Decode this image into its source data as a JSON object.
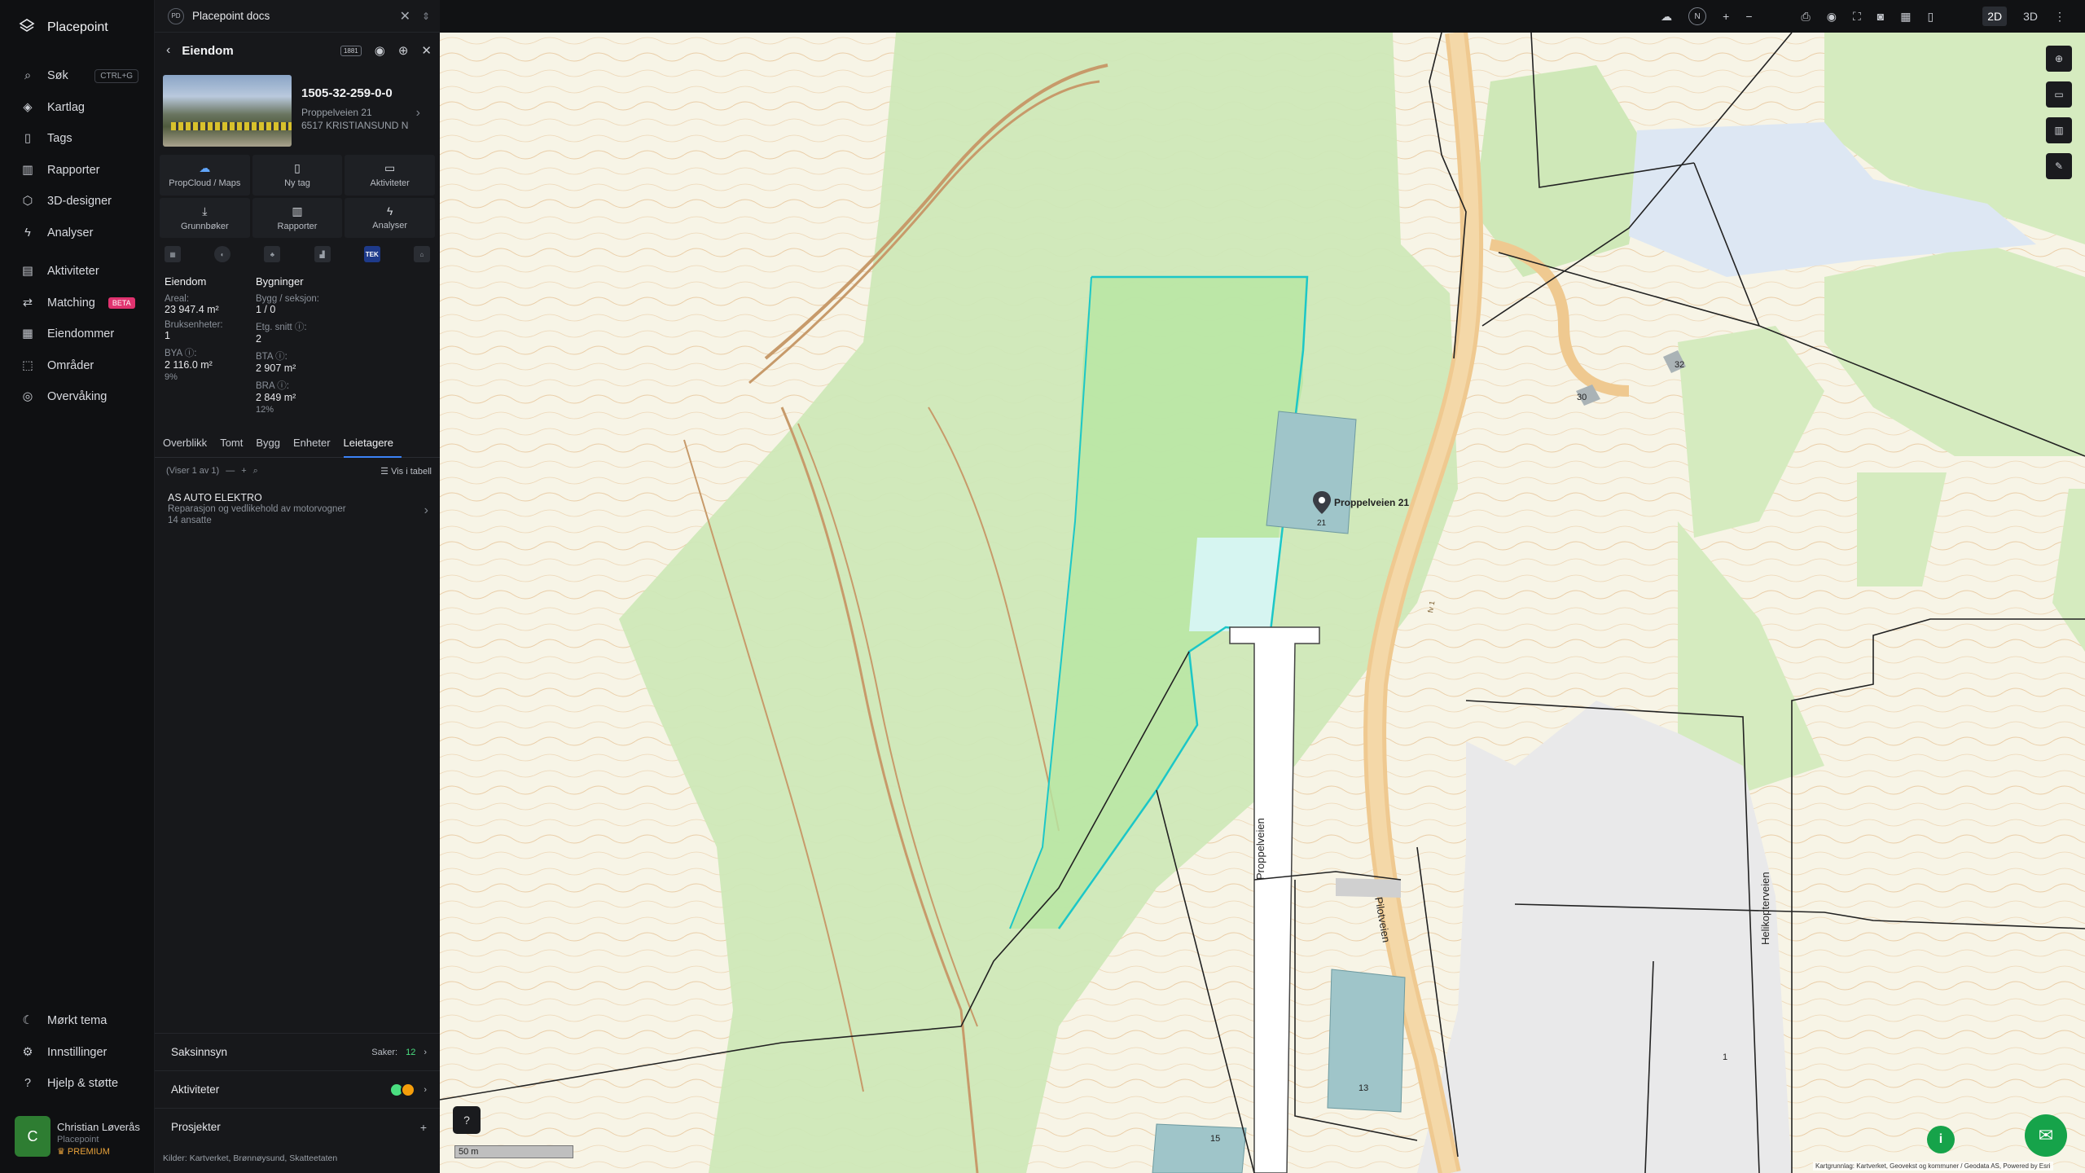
{
  "app": {
    "name": "Placepoint"
  },
  "nav": {
    "items": [
      {
        "label": "Søk",
        "icon": "search-icon",
        "shortcut": "CTRL+G"
      },
      {
        "label": "Kartlag",
        "icon": "layers-icon"
      },
      {
        "label": "Tags",
        "icon": "bookmark-icon"
      },
      {
        "label": "Rapporter",
        "icon": "chart-icon"
      },
      {
        "label": "3D-designer",
        "icon": "cube-icon"
      },
      {
        "label": "Analyser",
        "icon": "bolt-icon"
      }
    ],
    "items2": [
      {
        "label": "Aktiviteter",
        "icon": "activity-icon"
      },
      {
        "label": "Matching",
        "icon": "matching-icon",
        "badge": "BETA"
      },
      {
        "label": "Eiendommer",
        "icon": "building-icon"
      },
      {
        "label": "Områder",
        "icon": "area-icon"
      },
      {
        "label": "Overvåking",
        "icon": "monitor-icon"
      }
    ],
    "bottom": [
      {
        "label": "Mørkt tema",
        "icon": "moon-icon"
      },
      {
        "label": "Innstillinger",
        "icon": "gear-icon"
      },
      {
        "label": "Hjelp & støtte",
        "icon": "help-icon"
      }
    ],
    "user": {
      "initial": "C",
      "name": "Christian Løverås",
      "org": "Placepoint",
      "plan": "PREMIUM"
    }
  },
  "doc": {
    "badge": "PD",
    "title": "Placepoint docs"
  },
  "panel": {
    "title": "Eiendom",
    "badge": "1881",
    "property": {
      "id": "1505-32-259-0-0",
      "street": "Proppelveien 21",
      "city": "6517 KRISTIANSUND N"
    },
    "actions": [
      "PropCloud / Maps",
      "Ny tag",
      "Aktiviteter",
      "Grunnbøker",
      "Rapporter",
      "Analyser"
    ],
    "tek": "TEK",
    "eiendom": {
      "head": "Eiendom",
      "areal_label": "Areal:",
      "areal": "23 947.4 m²",
      "bruks_label": "Bruksenheter:",
      "bruks": "1",
      "bya_label": "BYA ⓘ:",
      "bya": "2 116.0 m²",
      "bya_pct": "9%"
    },
    "bygninger": {
      "head": "Bygninger",
      "bygg_label": "Bygg / seksjon:",
      "bygg": "1 / 0",
      "etg_label": "Etg. snitt ⓘ:",
      "etg": "2",
      "bta_label": "BTA ⓘ:",
      "bta": "2 907 m²",
      "bra_label": "BRA ⓘ:",
      "bra": "2 849 m²",
      "bra_pct": "12%"
    },
    "tabs": [
      "Overblikk",
      "Tomt",
      "Bygg",
      "Enheter",
      "Leietagere"
    ],
    "active_tab": "Leietagere",
    "list_info": "(Viser 1 av 1)",
    "view_table": "Vis i tabell",
    "tenant": {
      "name": "AS AUTO ELEKTRO",
      "desc": "Reparasjon og vedlikehold av motorvogner",
      "employees": "14 ansatte"
    },
    "sections": {
      "saksinnsyn": "Saksinnsyn",
      "saker_label": "Saker:",
      "saker": "12",
      "aktiviteter": "Aktiviteter",
      "prosjekter": "Prosjekter"
    },
    "sources_label": "Kilder:",
    "sources": "Kartverket,  Brønnøysund,  Skatteetaten"
  },
  "topbar": {
    "north": "N",
    "mode2d": "2D",
    "mode3d": "3D"
  },
  "map": {
    "labels": {
      "marker": "Proppelveien 21",
      "marker_sub": "21",
      "road1": "Proppelveien",
      "road2": "Pilotveien",
      "road3": "Helikopterveien",
      "n30": "30",
      "n32": "32",
      "n13": "13",
      "n15": "15",
      "n1": "1",
      "road_ref": "fv 1"
    },
    "scale": "50 m",
    "attribution": "Kartgrunnlag: Kartverket, Geovekst og kommuner / Geodata AS, Powered by Esri"
  }
}
